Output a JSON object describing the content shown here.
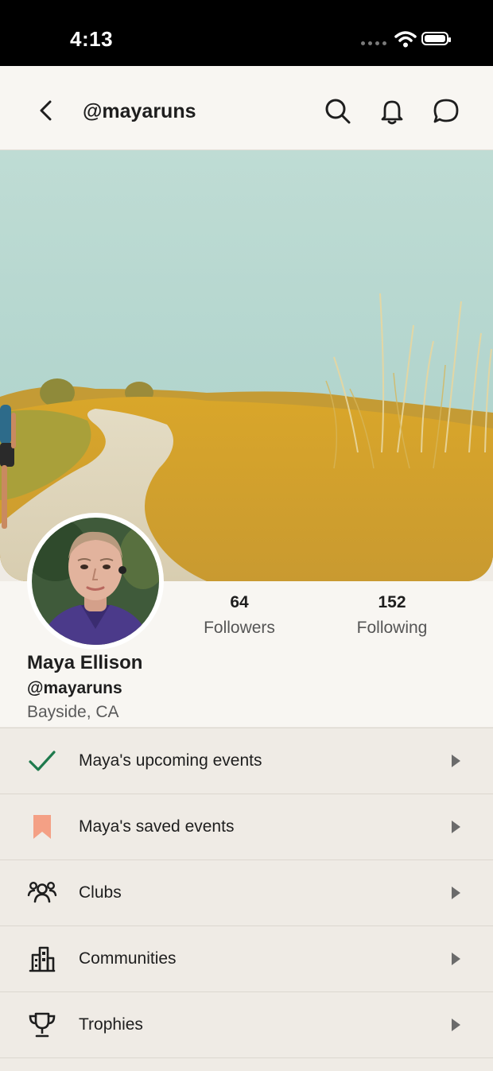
{
  "status_bar": {
    "time": "4:13"
  },
  "nav": {
    "title": "@mayaruns"
  },
  "profile": {
    "name": "Maya Ellison",
    "handle": "@mayaruns",
    "location": "Bayside, CA"
  },
  "stats": {
    "followers_value": "64",
    "followers_label": "Followers",
    "following_value": "152",
    "following_label": "Following"
  },
  "menu": {
    "items": [
      {
        "label": "Maya's upcoming events",
        "icon": "check-icon"
      },
      {
        "label": "Maya's saved events",
        "icon": "bookmark-icon"
      },
      {
        "label": "Clubs",
        "icon": "group-icon"
      },
      {
        "label": "Communities",
        "icon": "building-icon"
      },
      {
        "label": "Trophies",
        "icon": "trophy-icon"
      }
    ]
  },
  "colors": {
    "check": "#1f7a4d",
    "bookmark": "#f4a085",
    "background": "#efebe5"
  }
}
